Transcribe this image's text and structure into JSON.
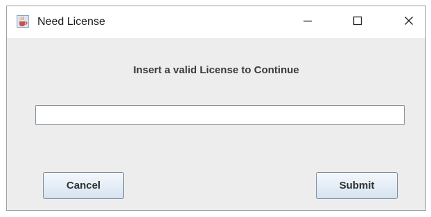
{
  "window": {
    "title": "Need License",
    "icon": "java-cup-icon",
    "controls": {
      "minimize_icon": "minimize-icon",
      "maximize_icon": "maximize-icon",
      "close_icon": "close-icon"
    }
  },
  "dialog": {
    "prompt": "Insert a valid License to Continue",
    "license_input": {
      "value": "",
      "placeholder": ""
    },
    "cancel_label": "Cancel",
    "submit_label": "Submit"
  },
  "colors": {
    "background": "#ededed",
    "titlebar": "#ffffff",
    "button_top": "#f4f8fc",
    "button_bottom": "#d6e3f0"
  }
}
